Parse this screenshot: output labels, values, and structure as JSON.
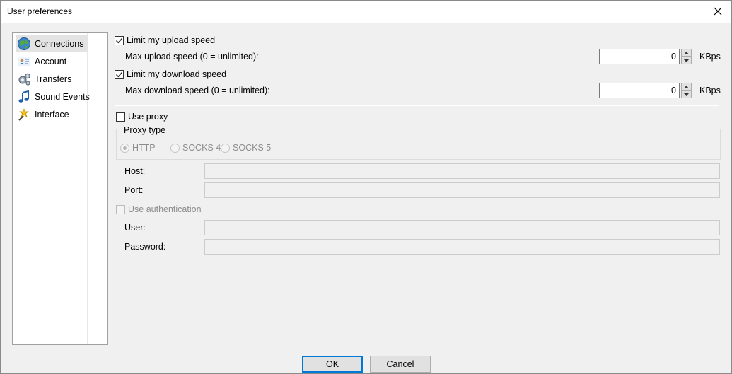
{
  "window": {
    "title": "User preferences"
  },
  "sidebar": {
    "items": [
      {
        "label": "Connections",
        "icon": "globe-icon"
      },
      {
        "label": "Account",
        "icon": "contact-card-icon"
      },
      {
        "label": "Transfers",
        "icon": "gears-icon"
      },
      {
        "label": "Sound Events",
        "icon": "music-note-icon"
      },
      {
        "label": "Interface",
        "icon": "interface-wand-icon"
      }
    ],
    "selected": "Connections"
  },
  "upload": {
    "checkbox_label": "Limit my upload speed",
    "checked": true,
    "field_label": "Max upload speed (0 = unlimited):",
    "value": "0",
    "unit": "KBps"
  },
  "download": {
    "checkbox_label": "Limit my download speed",
    "checked": true,
    "field_label": "Max download speed (0 = unlimited):",
    "value": "0",
    "unit": "KBps"
  },
  "proxy": {
    "use_label": "Use proxy",
    "checked": false,
    "type_legend": "Proxy type",
    "types": [
      "HTTP",
      "SOCKS 4",
      "SOCKS 5"
    ],
    "selected_type": "HTTP",
    "host_label": "Host:",
    "host_value": "",
    "port_label": "Port:",
    "port_value": "",
    "auth_label": "Use authentication",
    "auth_checked": false,
    "user_label": "User:",
    "user_value": "",
    "password_label": "Password:",
    "password_value": ""
  },
  "buttons": {
    "ok": "OK",
    "cancel": "Cancel"
  },
  "colors": {
    "accent": "#0078d7",
    "window_bg": "#f0f0f0",
    "disabled_text": "#8d8d8d"
  }
}
